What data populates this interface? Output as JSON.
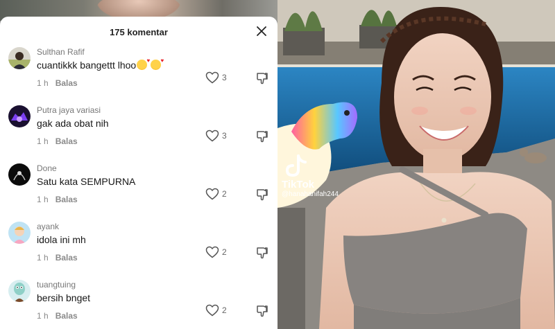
{
  "comments_panel": {
    "title": "175 komentar",
    "reply_label": "Balas",
    "comments": [
      {
        "username": "Sulthan Rafif",
        "text": "cuantikkk bangettt lhoo",
        "emojis": 2,
        "time": "1 h",
        "likes": "3"
      },
      {
        "username": "Putra jaya variasi",
        "text": "gak ada obat nih",
        "time": "1 h",
        "likes": "3"
      },
      {
        "username": "Done",
        "text": "Satu kata SEMPURNA",
        "time": "1 h",
        "likes": "2"
      },
      {
        "username": "ayank",
        "text": "idola ini mh",
        "time": "1 h",
        "likes": "2"
      },
      {
        "username": "tuangtuing",
        "text": "bersih bnget",
        "time": "1 h",
        "likes": "2"
      }
    ]
  },
  "video": {
    "watermark_brand": "TikTok",
    "watermark_handle": "@hanahanifah244"
  },
  "colors": {
    "sheet_bg": "#ffffff",
    "text_primary": "#161616",
    "text_secondary": "#8a8a8a",
    "pool_water": "#1e6fa6"
  },
  "icons": [
    "close-icon",
    "heart-icon",
    "dislike-icon",
    "tiktok-logo-icon"
  ]
}
